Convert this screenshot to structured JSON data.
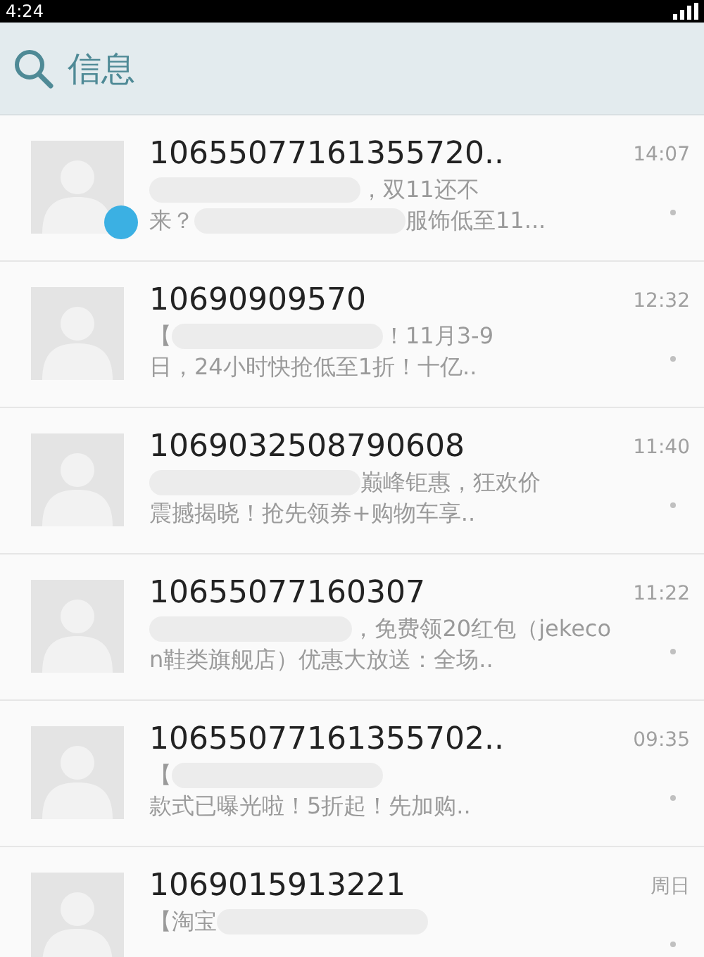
{
  "status_bar": {
    "time": "4:24"
  },
  "header": {
    "title": "信息"
  },
  "conversations": [
    {
      "sender": "10655077161355720..",
      "time": "14:07",
      "unread": true,
      "preview": [
        [
          {
            "kind": "blur"
          },
          {
            "kind": "text",
            "text": "，双11还不"
          }
        ],
        [
          {
            "kind": "text",
            "text": "来？"
          },
          {
            "kind": "blur"
          },
          {
            "kind": "text",
            "text": "服饰低至11..."
          }
        ]
      ]
    },
    {
      "sender": "10690909570",
      "time": "12:32",
      "unread": false,
      "preview": [
        [
          {
            "kind": "text",
            "text": "【"
          },
          {
            "kind": "blur"
          },
          {
            "kind": "text",
            "text": "！11月3-9"
          }
        ],
        [
          {
            "kind": "text",
            "text": "日，24小时快抢低至1折！十亿.."
          }
        ]
      ]
    },
    {
      "sender": "1069032508790608",
      "time": "11:40",
      "unread": false,
      "preview": [
        [
          {
            "kind": "blur"
          },
          {
            "kind": "text",
            "text": "巅峰钜惠，狂欢价"
          }
        ],
        [
          {
            "kind": "text",
            "text": "震撼揭晓！抢先领券+购物车享.."
          }
        ]
      ]
    },
    {
      "sender": "10655077160307",
      "time": "11:22",
      "unread": false,
      "preview": [
        [
          {
            "kind": "blur"
          },
          {
            "kind": "text",
            "text": "，免费领20红包（jekeco"
          }
        ],
        [
          {
            "kind": "text",
            "text": "n鞋类旗舰店）优惠大放送：全场.."
          }
        ]
      ]
    },
    {
      "sender": "10655077161355702..",
      "time": "09:35",
      "unread": false,
      "preview": [
        [
          {
            "kind": "text",
            "text": "【"
          },
          {
            "kind": "blur"
          }
        ],
        [
          {
            "kind": "text",
            "text": "款式已曝光啦！5折起！先加购.."
          }
        ]
      ]
    },
    {
      "sender": "1069015913221",
      "time": "周日",
      "unread": false,
      "preview": [
        [
          {
            "kind": "text",
            "text": "【淘宝"
          },
          {
            "kind": "blur"
          }
        ]
      ]
    }
  ]
}
